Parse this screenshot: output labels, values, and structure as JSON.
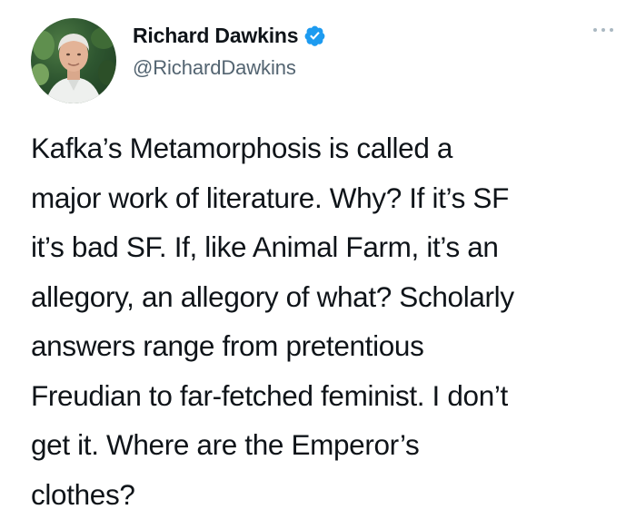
{
  "tweet": {
    "author": {
      "display_name": "Richard Dawkins",
      "handle": "@RichardDawkins",
      "verified_icon": "verified-badge-icon",
      "avatar_icon": "profile-photo"
    },
    "more_icon": "more-options-icon",
    "text_lines": [
      "Kafka’s Metamorphosis is called a",
      "major work of literature. Why? If it’s SF",
      "it’s bad SF. If, like Animal Farm, it’s an",
      "allegory, an allegory of what? Scholarly",
      "answers range from pretentious",
      "Freudian to far-fetched feminist. I don’t",
      "get it. Where are the Emperor’s",
      "clothes?"
    ]
  },
  "colors": {
    "text": "#0f1419",
    "secondary": "#536471",
    "verified": "#1d9bf0",
    "more_dots": "#aab8c2",
    "background": "#ffffff"
  }
}
